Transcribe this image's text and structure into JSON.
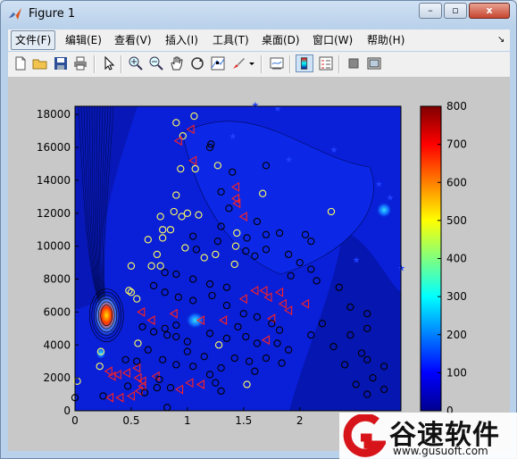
{
  "window": {
    "title": "Figure 1",
    "minimize": "–",
    "restore": "▫",
    "close": "x"
  },
  "menu": [
    "文件(F)",
    "编辑(E)",
    "查看(V)",
    "插入(I)",
    "工具(T)",
    "桌面(D)",
    "窗口(W)",
    "帮助(H)"
  ],
  "menu_dock": "↘",
  "toolbar": [
    "new-file-icon",
    "open-folder-icon",
    "save-icon",
    "print-icon",
    "pointer-icon",
    "zoom-in-icon",
    "zoom-out-icon",
    "pan-hand-icon",
    "rotate-3d-icon",
    "data-cursor-icon",
    "brush-icon",
    "link-plot-icon",
    "colorbar-icon",
    "legend-icon",
    "hide-plot-tools-icon",
    "show-plot-tools-icon"
  ],
  "colors": {
    "colormap_low": "#00008f",
    "colormap_mid": "#00ffff",
    "colormap_high": "#800000",
    "triangle": "#ff2020",
    "circle_yellow": "#ffff60",
    "circle_black": "#000000"
  },
  "chart_data": {
    "type": "scatter",
    "title": "",
    "xlabel": "",
    "ylabel": "",
    "xlim": [
      0,
      2.9
    ],
    "ylim": [
      0,
      18500
    ],
    "x_ticks": [
      "0",
      "0.5",
      "1",
      "1.5",
      "2"
    ],
    "y_ticks": [
      "0",
      "2000",
      "4000",
      "6000",
      "8000",
      "10000",
      "12000",
      "14000",
      "16000",
      "18000"
    ],
    "colorbar_ticks": [
      "0",
      "100",
      "200",
      "300",
      "400",
      "500",
      "600",
      "700",
      "800"
    ],
    "colorbar_lim": [
      0,
      800
    ],
    "series": [
      {
        "marker": "circle-yellow",
        "points": [
          [
            0.9,
            17500
          ],
          [
            1.06,
            17900
          ],
          [
            0.96,
            16700
          ],
          [
            0.94,
            14700
          ],
          [
            1.07,
            14700
          ],
          [
            1.27,
            14900
          ],
          [
            1.67,
            13200
          ],
          [
            0.9,
            13100
          ],
          [
            0.88,
            12100
          ],
          [
            0.95,
            11800
          ],
          [
            0.76,
            11800
          ],
          [
            1.0,
            12000
          ],
          [
            1.1,
            11900
          ],
          [
            0.78,
            11000
          ],
          [
            0.85,
            11000
          ],
          [
            0.65,
            10400
          ],
          [
            0.78,
            10500
          ],
          [
            0.73,
            9500
          ],
          [
            0.98,
            9900
          ],
          [
            1.15,
            9300
          ],
          [
            1.25,
            9500
          ],
          [
            0.68,
            8800
          ],
          [
            0.76,
            8800
          ],
          [
            0.5,
            8800
          ],
          [
            1.42,
            8900
          ],
          [
            1.43,
            10000
          ],
          [
            1.44,
            10800
          ],
          [
            2.28,
            12100
          ],
          [
            0.48,
            7300
          ],
          [
            0.5,
            7200
          ],
          [
            0.55,
            6800
          ],
          [
            0.56,
            4100
          ],
          [
            0.22,
            2700
          ],
          [
            0.02,
            1800
          ],
          [
            1.28,
            4000
          ],
          [
            1.53,
            1600
          ],
          [
            0.23,
            3600
          ]
        ]
      },
      {
        "marker": "triangle-red",
        "points": [
          [
            0.92,
            16400
          ],
          [
            1.03,
            17100
          ],
          [
            1.05,
            15200
          ],
          [
            1.43,
            13600
          ],
          [
            1.43,
            12900
          ],
          [
            1.5,
            11800
          ],
          [
            1.44,
            12600
          ],
          [
            0.59,
            6000
          ],
          [
            0.68,
            5500
          ],
          [
            0.88,
            5900
          ],
          [
            1.12,
            5500
          ],
          [
            1.32,
            5500
          ],
          [
            1.5,
            6800
          ],
          [
            1.6,
            7300
          ],
          [
            1.68,
            7300
          ],
          [
            1.72,
            6900
          ],
          [
            1.82,
            7200
          ],
          [
            1.85,
            6500
          ],
          [
            1.9,
            6100
          ],
          [
            1.75,
            5600
          ],
          [
            2.05,
            6500
          ],
          [
            1.7,
            4300
          ],
          [
            0.55,
            2600
          ],
          [
            0.56,
            2000
          ],
          [
            0.6,
            1800
          ],
          [
            0.46,
            2300
          ],
          [
            0.38,
            2200
          ],
          [
            0.33,
            2100
          ],
          [
            0.31,
            800
          ],
          [
            0.4,
            800
          ],
          [
            0.5,
            900
          ],
          [
            0.57,
            1200
          ],
          [
            0.6,
            1500
          ],
          [
            0.72,
            2100
          ],
          [
            0.93,
            1300
          ],
          [
            1.02,
            1700
          ],
          [
            1.12,
            1600
          ],
          [
            0.3,
            2400
          ]
        ]
      },
      {
        "marker": "circle-black",
        "points": [
          [
            1.21,
            16200
          ],
          [
            1.2,
            16000
          ],
          [
            1.7,
            14900
          ],
          [
            1.4,
            14500
          ],
          [
            1.3,
            13300
          ],
          [
            1.37,
            12300
          ],
          [
            1.3,
            11200
          ],
          [
            1.62,
            11500
          ],
          [
            1.7,
            10700
          ],
          [
            1.82,
            10800
          ],
          [
            2.05,
            10700
          ],
          [
            2.1,
            10300
          ],
          [
            1.05,
            10600
          ],
          [
            1.08,
            9800
          ],
          [
            1.27,
            10300
          ],
          [
            1.53,
            10500
          ],
          [
            1.52,
            9700
          ],
          [
            1.6,
            9400
          ],
          [
            1.7,
            9800
          ],
          [
            1.9,
            9500
          ],
          [
            2.0,
            9000
          ],
          [
            2.1,
            8600
          ],
          [
            0.8,
            8400
          ],
          [
            0.9,
            8300
          ],
          [
            1.05,
            8000
          ],
          [
            1.2,
            7700
          ],
          [
            1.35,
            7500
          ],
          [
            0.7,
            7600
          ],
          [
            0.8,
            7200
          ],
          [
            0.92,
            6900
          ],
          [
            1.05,
            6700
          ],
          [
            1.22,
            7000
          ],
          [
            1.35,
            6400
          ],
          [
            1.5,
            5900
          ],
          [
            1.62,
            5700
          ],
          [
            1.75,
            5300
          ],
          [
            1.82,
            4900
          ],
          [
            1.2,
            4700
          ],
          [
            1.35,
            4400
          ],
          [
            1.45,
            5100
          ],
          [
            1.52,
            4500
          ],
          [
            1.62,
            4100
          ],
          [
            1.8,
            4100
          ],
          [
            1.9,
            3700
          ],
          [
            1.42,
            3200
          ],
          [
            1.55,
            3000
          ],
          [
            1.7,
            3200
          ],
          [
            1.84,
            2900
          ],
          [
            1.6,
            2400
          ],
          [
            1.3,
            2600
          ],
          [
            1.15,
            3300
          ],
          [
            1.0,
            3600
          ],
          [
            1.0,
            4200
          ],
          [
            0.9,
            4500
          ],
          [
            0.82,
            4600
          ],
          [
            0.7,
            4800
          ],
          [
            0.6,
            5100
          ],
          [
            0.8,
            5000
          ],
          [
            0.9,
            5200
          ],
          [
            0.65,
            3700
          ],
          [
            0.78,
            3100
          ],
          [
            0.9,
            2800
          ],
          [
            1.05,
            2700
          ],
          [
            1.2,
            2200
          ],
          [
            1.25,
            1700
          ],
          [
            1.3,
            1200
          ],
          [
            0.85,
            1400
          ],
          [
            0.73,
            1400
          ],
          [
            0.62,
            1100
          ],
          [
            0.75,
            1900
          ],
          [
            0.55,
            3000
          ],
          [
            0.45,
            3100
          ],
          [
            0.47,
            1500
          ],
          [
            0.25,
            900
          ],
          [
            0.82,
            200
          ],
          [
            2.45,
            6300
          ],
          [
            2.6,
            5900
          ],
          [
            2.6,
            5000
          ],
          [
            2.45,
            4600
          ],
          [
            2.3,
            3900
          ],
          [
            2.55,
            3500
          ],
          [
            2.4,
            2800
          ],
          [
            2.6,
            3100
          ],
          [
            2.75,
            2700
          ],
          [
            2.65,
            2000
          ],
          [
            2.5,
            1600
          ],
          [
            2.6,
            1000
          ],
          [
            2.75,
            1300
          ],
          [
            2.1,
            4600
          ],
          [
            2.2,
            5300
          ],
          [
            1.92,
            8200
          ],
          [
            2.15,
            7900
          ],
          [
            2.35,
            7500
          ],
          [
            0.0,
            800
          ]
        ]
      },
      {
        "marker": "star-blue",
        "points": [
          [
            1.6,
            18600
          ],
          [
            1.8,
            18400
          ],
          [
            2.9,
            8700
          ],
          [
            2.5,
            9200
          ],
          [
            2.7,
            13800
          ],
          [
            1.9,
            15300
          ],
          [
            2.3,
            15900
          ],
          [
            1.4,
            16700
          ],
          [
            2.8,
            13000
          ]
        ]
      }
    ]
  },
  "watermark": {
    "name": "谷速软件",
    "url": "www.gusuoft.com"
  }
}
